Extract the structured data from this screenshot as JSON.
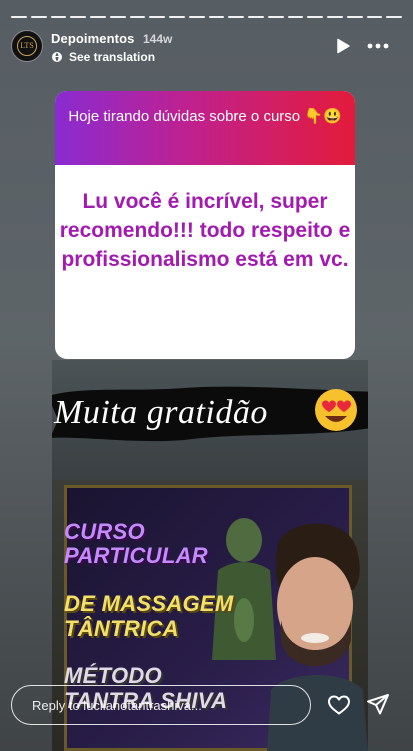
{
  "header": {
    "account_name": "Depoimentos",
    "age": "144w",
    "translation_label": "See translation",
    "avatar_text": "LTS"
  },
  "question_sticker": {
    "prompt": "Hoje tirando dúvidas sobre o curso 👇😃",
    "answer": "Lu você é incrível, super recomendo!!! todo respeito e profissionalismo está em vc."
  },
  "photo": {
    "banner_text": "Muita gratidão",
    "poster_lines": [
      "CURSO",
      "PARTICULAR",
      "DE MASSAGEM",
      "TÂNTRICA",
      "MÉTODO",
      "TANTRA SHIVA"
    ]
  },
  "footer": {
    "reply_placeholder": "Reply to luciianotantrashiva..."
  },
  "colors": {
    "sticker_gradient_start": "#8a2bd1",
    "sticker_gradient_end": "#e31b3b",
    "answer_text": "#a21ab0"
  },
  "icons": [
    "play-icon",
    "more-icon",
    "translate-icon",
    "heart-icon",
    "send-icon"
  ]
}
